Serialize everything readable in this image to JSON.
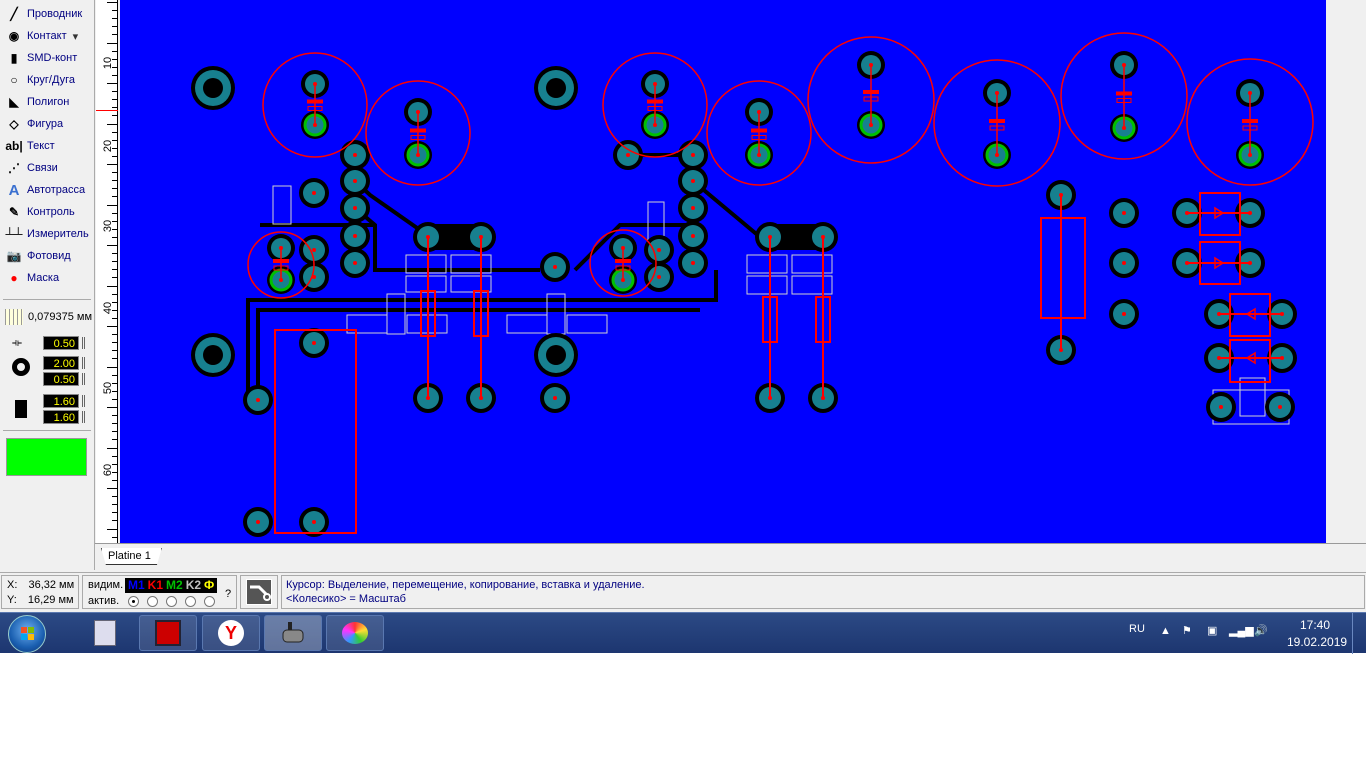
{
  "toolbar": {
    "tools": [
      {
        "label": "Проводник",
        "icon": "wire-icon"
      },
      {
        "label": "Контакт",
        "icon": "contact-icon"
      },
      {
        "label": "SMD-конт",
        "icon": "smd-pad-icon"
      },
      {
        "label": "Круг/Дуга",
        "icon": "circle-arc-icon"
      },
      {
        "label": "Полигон",
        "icon": "polygon-icon"
      },
      {
        "label": "Фигура",
        "icon": "shape-icon"
      },
      {
        "label": "Текст",
        "icon": "text-icon"
      },
      {
        "label": "Связи",
        "icon": "connections-icon"
      },
      {
        "label": "Автотрасса",
        "icon": "autoroute-icon"
      },
      {
        "label": "Контроль",
        "icon": "check-icon"
      },
      {
        "label": "Измеритель",
        "icon": "measure-icon"
      },
      {
        "label": "Фотовид",
        "icon": "photoview-icon"
      },
      {
        "label": "Маска",
        "icon": "mask-icon"
      }
    ],
    "grid": "0,079375 мм",
    "track_width": "0.50",
    "pad_outer": "2.00",
    "pad_inner": "0.50",
    "smd_width": "1.60",
    "smd_height": "1.60",
    "text_icon": "ab|",
    "active_color": "#00ff00"
  },
  "ruler": {
    "labels": [
      "10",
      "20",
      "30",
      "40",
      "50",
      "60"
    ]
  },
  "tabs": [
    "Platine 1"
  ],
  "status": {
    "x_label": "X:",
    "x": "36,32 мм",
    "y_label": "Y:",
    "y": "16,29 мм",
    "visible_label": "видим.",
    "active_label": "актив.",
    "layers": [
      {
        "name": "M1",
        "color": "#0000ff"
      },
      {
        "name": "K1",
        "color": "#ff0000"
      },
      {
        "name": "M2",
        "color": "#00c000"
      },
      {
        "name": "K2",
        "color": "#c0c0c0"
      },
      {
        "name": "Ф",
        "color": "#ffff00"
      }
    ],
    "help": "?",
    "hint1": "Курсор: Выделение, перемещение, копирование, вставка и удаление.",
    "hint2": "<Колесико> = Масштаб"
  },
  "taskbar": {
    "lang": "RU",
    "time": "17:40",
    "date": "19.02.2019"
  },
  "colors": {
    "board": "#0000ff",
    "pad": "#17808f",
    "copper2": "#00c000",
    "silk": "#ff0000",
    "outline": "#d0d0d0"
  }
}
